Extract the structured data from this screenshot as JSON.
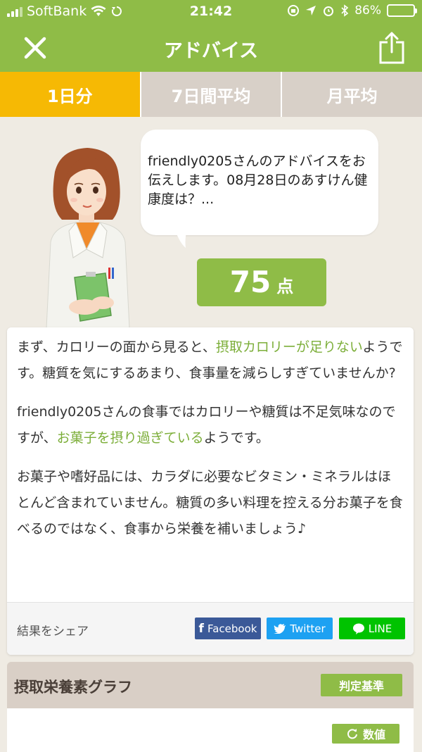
{
  "status": {
    "carrier": "SoftBank",
    "time": "21:42",
    "battery": "86%",
    "battery_level": 0.86
  },
  "nav": {
    "title": "アドバイス",
    "close_icon": "close-icon",
    "share_icon": "share-icon"
  },
  "tabs": [
    {
      "label": "1日分",
      "active": true
    },
    {
      "label": "7日間平均",
      "active": false
    },
    {
      "label": "月平均",
      "active": false
    }
  ],
  "bubble": {
    "text": "friendly0205さんのアドバイスをお伝えします。08月28日のあすけん健康度は？..."
  },
  "score": {
    "value": "75",
    "unit": "点"
  },
  "advice": {
    "p1_a": "まず、カロリーの面から見ると、",
    "p1_hl": "摂取カロリーが足りない",
    "p1_b": "ようです。糖質を気にするあまり、食事量を減らしすぎていませんか?",
    "p2_a": "friendly0205さんの食事ではカロリーや糖質は不足気味なのですが、",
    "p2_hl": "お菓子を摂り過ぎている",
    "p2_b": "ようです。",
    "p3": "お菓子や嗜好品には、カラダに必要なビタミン・ミネラルはほとんど含まれていません。糖質の多い料理を控える分お菓子を食べるのではなく、食事から栄養を補いましょう♪"
  },
  "share": {
    "label": "結果をシェア",
    "facebook": "Facebook",
    "twitter": "Twitter",
    "line": "LINE"
  },
  "graph": {
    "title": "摂取栄養素グラフ",
    "criteria_button": "判定基準",
    "values_button": "数値"
  },
  "colors": {
    "brand_green": "#8fbc47",
    "tab_active": "#f6b904",
    "highlight": "#7cae39"
  }
}
